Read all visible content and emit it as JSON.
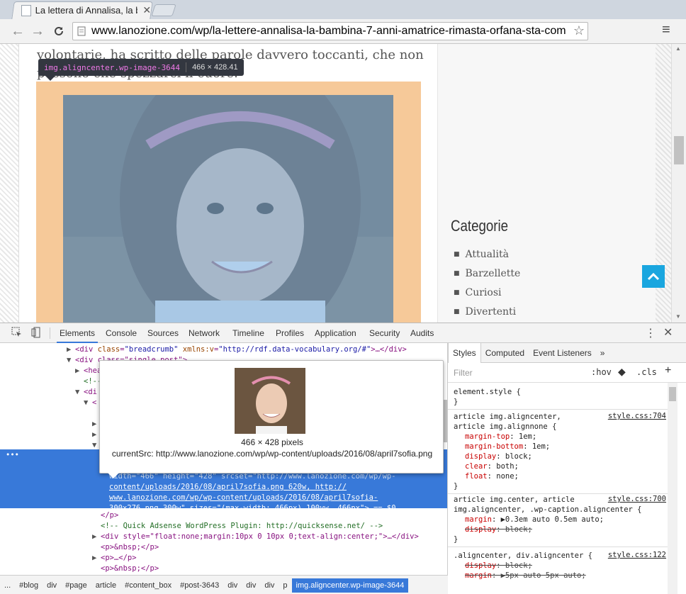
{
  "browser": {
    "tab_title": "La lettera di Annalisa, la b",
    "tab_close": "✕",
    "url": "www.lanozione.com/wp/la-lettere-annalisa-la-bambina-7-anni-amatrice-rimasta-orfana-sta-com",
    "back_icon": "←",
    "forward_icon": "→",
    "reload_icon": "C",
    "star_icon": "☆",
    "menu_icon": "≡"
  },
  "page": {
    "text_line_1": "volontarie, ha scritto delle parole davvero toccanti, che non",
    "text_line_2": "possono che spezzarci il cuore.",
    "hover_tooltip": {
      "selector": "img.aligncenter.wp-image-3644",
      "dims": "466 × 428.41"
    },
    "sidebar": {
      "title": "Categorie",
      "items": [
        "Attualità",
        "Barzellette",
        "Curiosi",
        "Divertenti"
      ]
    },
    "back_to_top_icon": "⌃"
  },
  "devtools": {
    "tabs": [
      "Elements",
      "Console",
      "Sources",
      "Network",
      "Timeline",
      "Profiles",
      "Application",
      "Security",
      "Audits"
    ],
    "kebab": "⋮",
    "close": "✕",
    "elements": {
      "line_breadcrumb": {
        "tag": "div",
        "attr": "class",
        "val": "\"breadcrumb\"",
        "attr2": "xmlns:v",
        "val2": "\"http://rdf.data-vocabulary.org/#\"",
        "tail": ">…</div>"
      },
      "line_singlepost": "<div class=\"single_post\">",
      "line_header": "<hea",
      "line_comment": "<!--",
      "line_div1": "<di",
      "line_div2": "<",
      "selected_lines": [
        "width=\"466\" height=\"428\" srcset=\"http://www.lanozione.com/wp/wp-",
        "content/uploads/2016/08/april7sofia.png 620w, http://",
        "www.lanozione.com/wp/wp-content/uploads/2016/08/april7sofia-",
        "300x276.png 300w\" sizes=\"(max-width: 466px) 100vw, 466px\"> == $0"
      ],
      "line_close_p": "</p>",
      "line_adsense": "<!-- Quick Adsense WordPress Plugin: http://quicksense.net/ -->",
      "line_div_float": "<div style=\"float:none;margin:10px 0 10px 0;text-align:center;\">…</div>",
      "line_p_nbsp": "<p>&nbsp;</p>",
      "line_p_dots": "<p>…</p>",
      "line_p_nbsp2": "<p>&nbsp;</p>"
    },
    "image_tooltip": {
      "pixels": "466 × 428 pixels",
      "current_src": "currentSrc: http://www.lanozione.com/wp/wp-content/uploads/2016/08/april7sofia.png"
    },
    "breadcrumbs": [
      "...",
      "#blog",
      "div",
      "#page",
      "article",
      "#content_box",
      "#post-3643",
      "div",
      "div",
      "div",
      "p",
      "img.aligncenter.wp-image-3644"
    ],
    "styles_tabs": [
      "Styles",
      "Computed",
      "Event Listeners",
      "»"
    ],
    "filter_placeholder": "Filter",
    "hov": ":hov",
    "cls": ".cls",
    "plus": "+",
    "rules": {
      "element_style": "element.style {",
      "close": "}",
      "r1_sel1": "article img.aligncenter,",
      "r1_sel2": "article img.alignnone {",
      "r1_link": "style.css:704",
      "r1_props": [
        {
          "name": "margin-top",
          "value": "1em;"
        },
        {
          "name": "margin-bottom",
          "value": "1em;"
        },
        {
          "name": "display",
          "value": "block;"
        },
        {
          "name": "clear",
          "value": "both;"
        },
        {
          "name": "float",
          "value": "none;"
        }
      ],
      "r2_sel1": "article img.center, article",
      "r2_sel2": "img.aligncenter, .wp-caption.aligncenter {",
      "r2_link": "style.css:700",
      "r2_margin": {
        "name": "margin",
        "value": "▶0.3em auto 0.5em auto;"
      },
      "r2_display": {
        "name": "display",
        "value": "block;"
      },
      "r3_sel": ".aligncenter, div.aligncenter {",
      "r3_link": "style.css:122",
      "r3_display": {
        "name": "display",
        "value": "block;"
      },
      "r3_margin": {
        "name": "margin",
        "value": "▶5px auto 5px auto;"
      }
    }
  },
  "colors": {
    "selection": "#3879d9",
    "highlight_margin": "#f6c999",
    "highlight_content": "#6fa8dc",
    "back_to_top": "#1aa6df"
  }
}
